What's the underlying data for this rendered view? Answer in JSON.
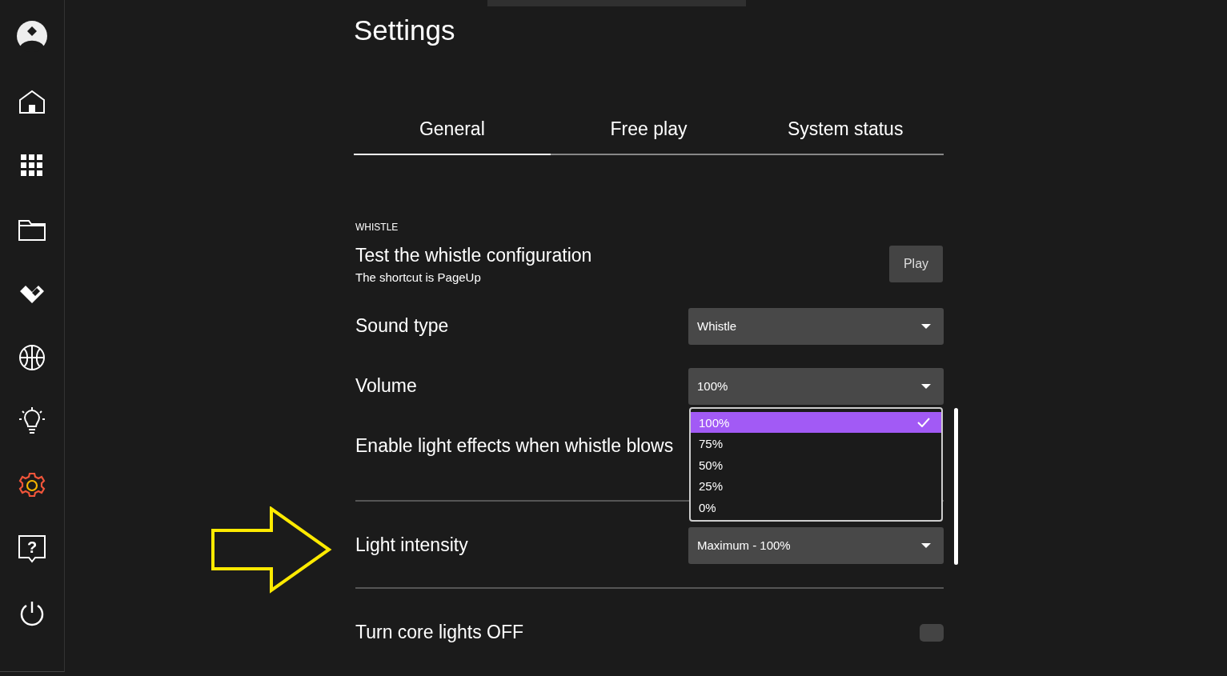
{
  "sidebar": {
    "items": [
      {
        "selected": false
      },
      {
        "selected": false
      },
      {
        "selected": false
      },
      {
        "selected": false
      },
      {
        "selected": false
      },
      {
        "selected": false
      },
      {
        "selected": false
      },
      {
        "selected": true
      },
      {
        "selected": false,
        "glyph": "?"
      },
      {
        "selected": false
      }
    ]
  },
  "title": "Settings",
  "tabs": [
    {
      "label": "General",
      "selected": true
    },
    {
      "label": "Free play",
      "selected": false
    },
    {
      "label": "System status",
      "selected": false
    }
  ],
  "section": "WHISTLE",
  "rows": [
    {
      "kind": "button",
      "label": "Test the whistle configuration",
      "hint": "The shortcut is PageUp",
      "button": "Play"
    },
    {
      "kind": "select",
      "label": "Sound type",
      "value": "Whistle"
    },
    {
      "kind": "select",
      "label": "Volume",
      "value": "100%",
      "menu": [
        {
          "label": "100%",
          "selected": true
        },
        {
          "label": "75%",
          "selected": false
        },
        {
          "label": "50%",
          "selected": false
        },
        {
          "label": "25%",
          "selected": false
        },
        {
          "label": "0%",
          "selected": false
        }
      ]
    },
    {
      "kind": "plain",
      "label": "Enable light effects when whistle blows"
    },
    {
      "kind": "divider"
    },
    {
      "kind": "select",
      "label": "Light intensity",
      "value": "Maximum - 100%"
    },
    {
      "kind": "divider"
    },
    {
      "kind": "toggle",
      "label": "Turn core lights OFF",
      "on": false
    }
  ]
}
